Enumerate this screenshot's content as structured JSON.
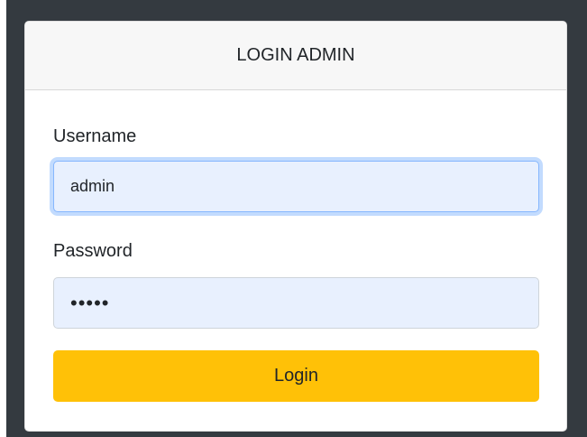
{
  "login_card": {
    "title": "LOGIN ADMIN",
    "username": {
      "label": "Username",
      "value": "admin"
    },
    "password": {
      "label": "Password",
      "value": "•••••"
    },
    "submit_label": "Login"
  },
  "colors": {
    "page_background": "#343a40",
    "header_background": "#f7f7f7",
    "autofill_background": "#e8f0fe",
    "focus_border": "#86b7fe",
    "login_button": "#ffc107"
  }
}
